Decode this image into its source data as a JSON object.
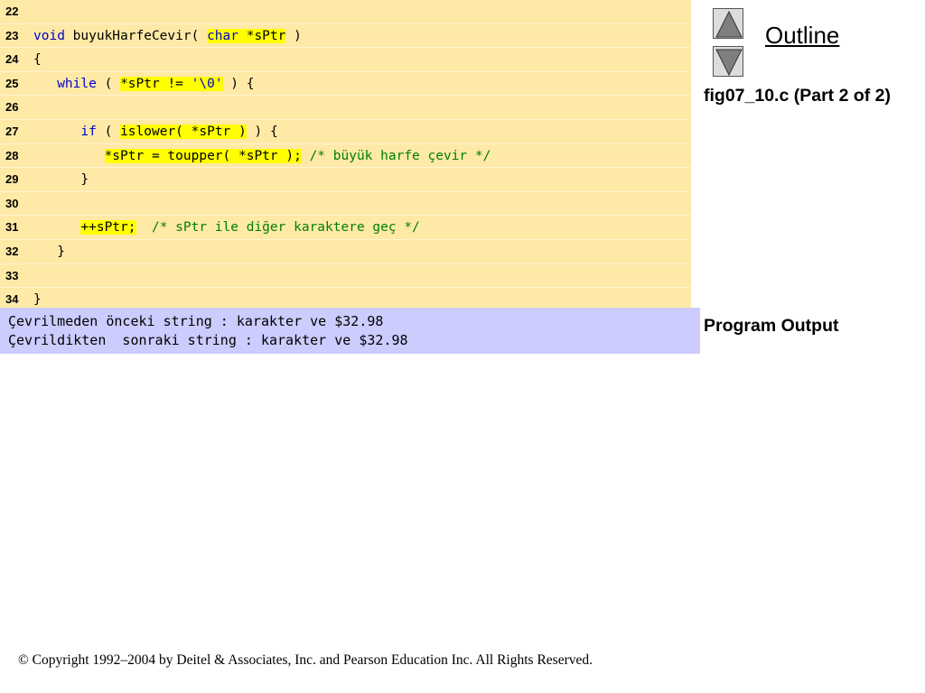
{
  "code": {
    "lines": [
      {
        "num": "22"
      },
      {
        "num": "23",
        "parts": [
          {
            "t": "void",
            "c": "kw"
          },
          {
            "t": " buyukHarfeCevir( "
          },
          {
            "t": "char",
            "c": "kw hl"
          },
          {
            "t": " *sPtr",
            "c": "hl"
          },
          {
            "t": " )"
          }
        ]
      },
      {
        "num": "24",
        "parts": [
          {
            "t": "{"
          }
        ]
      },
      {
        "num": "25",
        "parts": [
          {
            "t": "   "
          },
          {
            "t": "while",
            "c": "kw"
          },
          {
            "t": " ( "
          },
          {
            "t": "*sPtr != ",
            "c": "hl"
          },
          {
            "t": "'\\0'",
            "c": "str hl"
          },
          {
            "t": " ) {"
          }
        ]
      },
      {
        "num": "26"
      },
      {
        "num": "27",
        "parts": [
          {
            "t": "      "
          },
          {
            "t": "if",
            "c": "kw"
          },
          {
            "t": " ( "
          },
          {
            "t": "islower( *sPtr )",
            "c": "hl"
          },
          {
            "t": " ) {"
          }
        ]
      },
      {
        "num": "28",
        "parts": [
          {
            "t": "         "
          },
          {
            "t": "*sPtr = toupper( *sPtr );",
            "c": "hl"
          },
          {
            "t": " "
          },
          {
            "t": "/* büyük harfe çevir */",
            "c": "cm"
          }
        ]
      },
      {
        "num": "29",
        "parts": [
          {
            "t": "      }"
          }
        ]
      },
      {
        "num": "30"
      },
      {
        "num": "31",
        "parts": [
          {
            "t": "      "
          },
          {
            "t": "++sPtr;",
            "c": "hl"
          },
          {
            "t": "  "
          },
          {
            "t": "/* sPtr ile diğer karaktere geç */",
            "c": "cm"
          }
        ]
      },
      {
        "num": "32",
        "parts": [
          {
            "t": "   }"
          }
        ]
      },
      {
        "num": "33"
      },
      {
        "num": "34",
        "parts": [
          {
            "t": "}"
          }
        ]
      }
    ]
  },
  "output": {
    "lines": [
      "Çevrilmeden önceki string : karakter ve $32.98",
      "Çevrildikten  sonraki string : karakter ve $32.98"
    ]
  },
  "sidebar": {
    "outline_label": "Outline",
    "up_icon": "triangle-up-icon",
    "down_icon": "triangle-down-icon",
    "figure_title": "fig07_10.c (Part 2 of 2)",
    "program_output_label": "Program Output"
  },
  "footer": {
    "copyright": "© Copyright 1992–2004 by Deitel & Associates, Inc. and Pearson Education Inc. All Rights Reserved."
  },
  "colors": {
    "code_bg": "#ffe9a6",
    "output_bg": "#ccccff",
    "highlight": "#ffff00",
    "keyword": "#0000cc",
    "comment": "#008000"
  }
}
